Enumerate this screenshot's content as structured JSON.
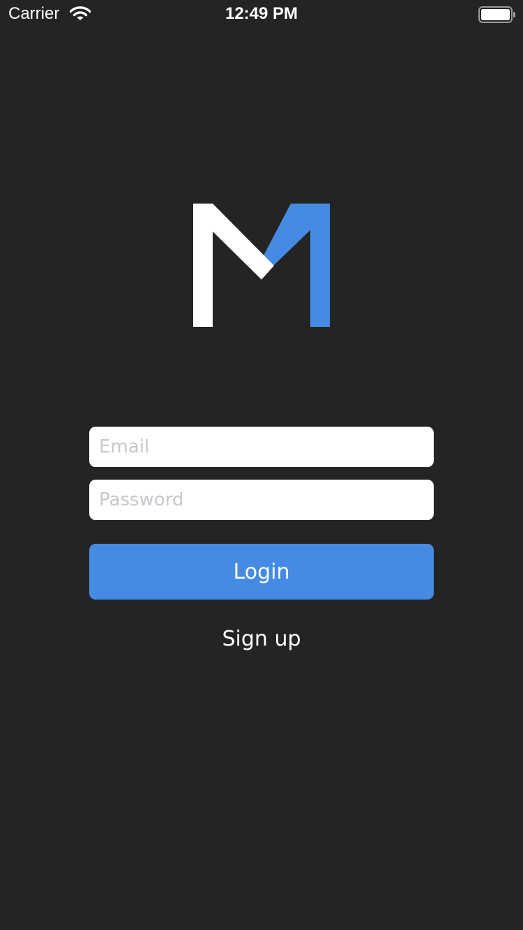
{
  "status_bar": {
    "carrier": "Carrier",
    "time": "12:49 PM",
    "wifi_icon": "wifi-icon",
    "battery_icon": "battery-full-icon"
  },
  "logo": {
    "icon": "m-logo-icon",
    "colors": {
      "left": "#ffffff",
      "right": "#458be3"
    }
  },
  "form": {
    "email_placeholder": "Email",
    "password_placeholder": "Password",
    "login_label": "Login",
    "signup_label": "Sign up"
  },
  "colors": {
    "background": "#242424",
    "accent": "#458be3",
    "field_background": "#ffffff",
    "placeholder": "#c7c7cd"
  }
}
